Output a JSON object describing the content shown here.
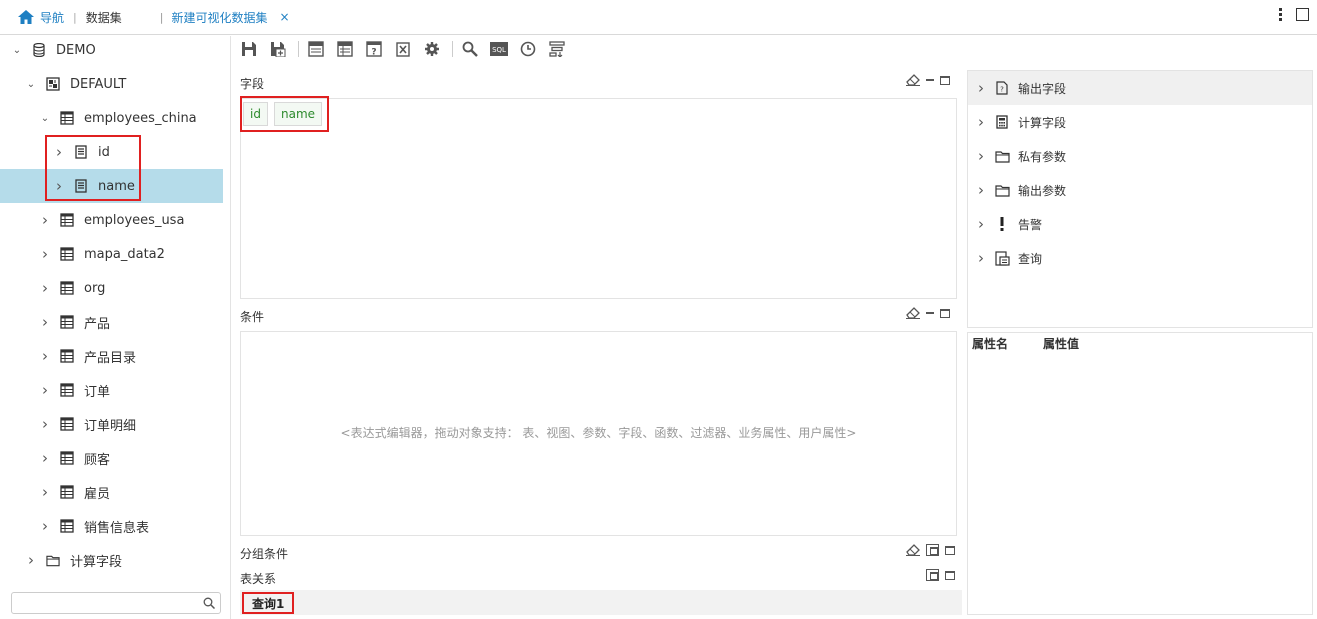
{
  "topbar": {
    "nav_label": "导航",
    "crumb": "数据集",
    "tab_label": "新建可视化数据集",
    "tab_close": "×"
  },
  "tree": {
    "items": [
      {
        "label": "DEMO",
        "icon": "database-icon",
        "expanded": true
      },
      {
        "label": "DEFAULT",
        "icon": "schema-icon",
        "expanded": true
      },
      {
        "label": "employees_china",
        "icon": "table-icon",
        "expanded": true
      },
      {
        "label": "id",
        "icon": "field-icon",
        "expanded": false
      },
      {
        "label": "name",
        "icon": "field-icon",
        "expanded": false,
        "selected": true
      },
      {
        "label": "employees_usa",
        "icon": "table-icon",
        "expanded": false
      },
      {
        "label": "mapa_data2",
        "icon": "table-icon",
        "expanded": false
      },
      {
        "label": "org",
        "icon": "table-icon",
        "expanded": false
      },
      {
        "label": "产品",
        "icon": "table-icon",
        "expanded": false
      },
      {
        "label": "产品目录",
        "icon": "table-icon",
        "expanded": false
      },
      {
        "label": "订单",
        "icon": "table-icon",
        "expanded": false
      },
      {
        "label": "订单明细",
        "icon": "table-icon",
        "expanded": false
      },
      {
        "label": "顾客",
        "icon": "table-icon",
        "expanded": false
      },
      {
        "label": "雇员",
        "icon": "table-icon",
        "expanded": false
      },
      {
        "label": "销售信息表",
        "icon": "table-icon",
        "expanded": false
      },
      {
        "label": "计算字段",
        "icon": "folder-icon",
        "expanded": false
      }
    ],
    "search_placeholder": ""
  },
  "toolbar": {
    "icons": [
      "save-icon",
      "save-as-icon",
      "layout-icon",
      "columns-icon",
      "help-icon",
      "export-icon",
      "settings-icon",
      "search-icon",
      "sql-icon",
      "history-icon",
      "filter-icon"
    ],
    "sql_text": "SQL"
  },
  "sections": {
    "fields_title": "字段",
    "fields": [
      "id",
      "name"
    ],
    "conditions_title": "条件",
    "conditions_hint": "<表达式编辑器，拖动对象支持： 表、视图、参数、字段、函数、过滤器、业务属性、用户属性>",
    "group_title": "分组条件",
    "relation_title": "表关系",
    "query_tab": "查询1"
  },
  "right_panel": {
    "items": [
      {
        "label": "输出字段",
        "icon": "output-field-icon"
      },
      {
        "label": "计算字段",
        "icon": "calculator-icon"
      },
      {
        "label": "私有参数",
        "icon": "folder-icon"
      },
      {
        "label": "输出参数",
        "icon": "folder-icon"
      },
      {
        "label": "告警",
        "icon": "alert-icon"
      },
      {
        "label": "查询",
        "icon": "query-icon"
      }
    ],
    "prop_name_header": "属性名",
    "prop_value_header": "属性值"
  },
  "colors": {
    "accent": "#1e7fc2",
    "selected_row": "#b5dcea",
    "highlight_box": "#e02020",
    "field_text": "#2d8a2d"
  }
}
